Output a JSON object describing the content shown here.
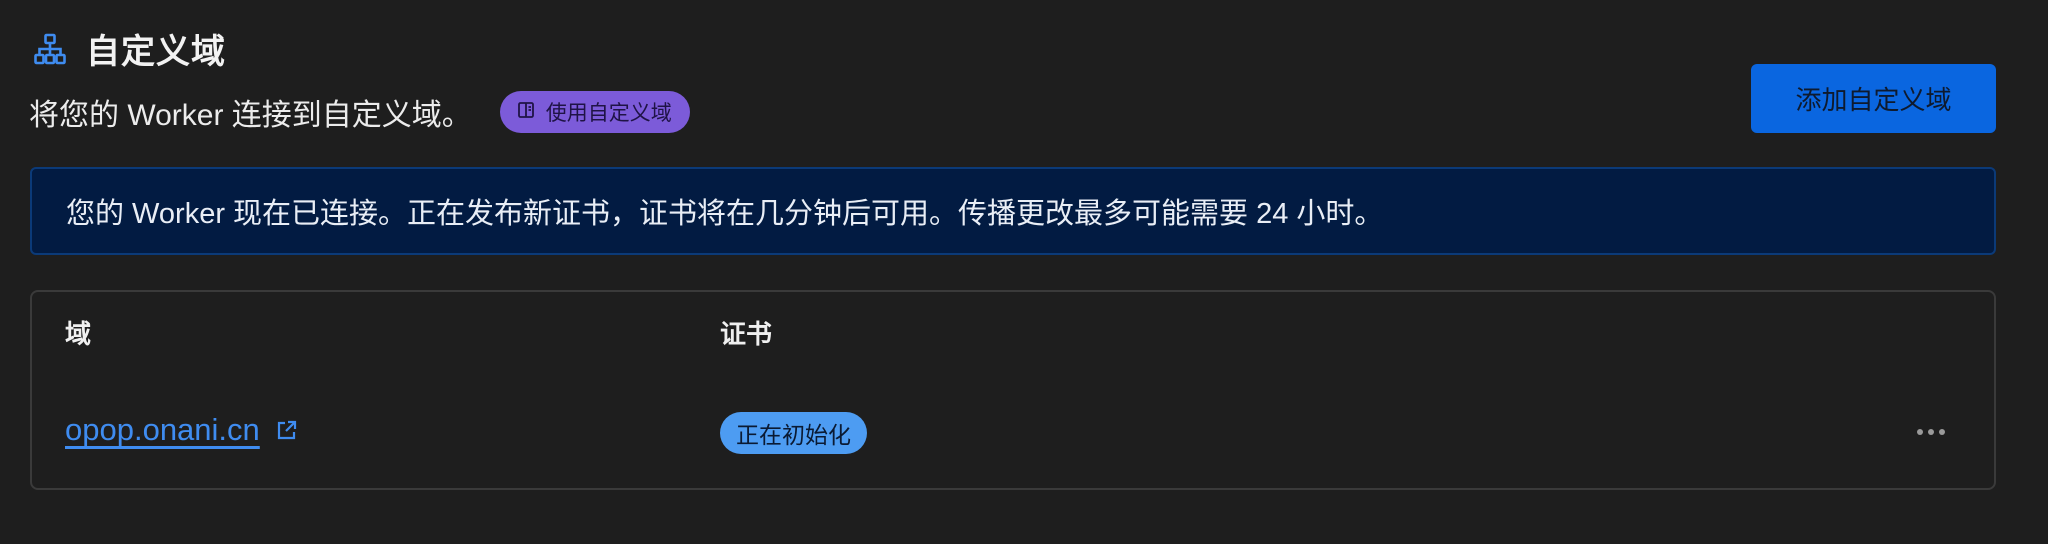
{
  "section": {
    "title": "自定义域",
    "icon": "sitemap-icon",
    "description": "将您的 Worker 连接到自定义域。",
    "docs_badge_label": "使用自定义域",
    "docs_badge_icon": "book-icon"
  },
  "actions": {
    "add_button_label": "添加自定义域"
  },
  "notice": {
    "text": "您的 Worker 现在已连接。正在发布新证书，证书将在几分钟后可用。传播更改最多可能需要 24 小时。"
  },
  "table": {
    "columns": [
      "域",
      "证书"
    ],
    "rows": [
      {
        "domain": "opop.onani.cn",
        "certificate_status": "正在初始化"
      }
    ]
  },
  "colors": {
    "background": "#1e1e1e",
    "accent": "#0a66e0",
    "link": "#3f8cf0",
    "docs_badge": "#7c5bd9",
    "status_badge": "#4d9cf2",
    "notice_background": "#021b42"
  }
}
